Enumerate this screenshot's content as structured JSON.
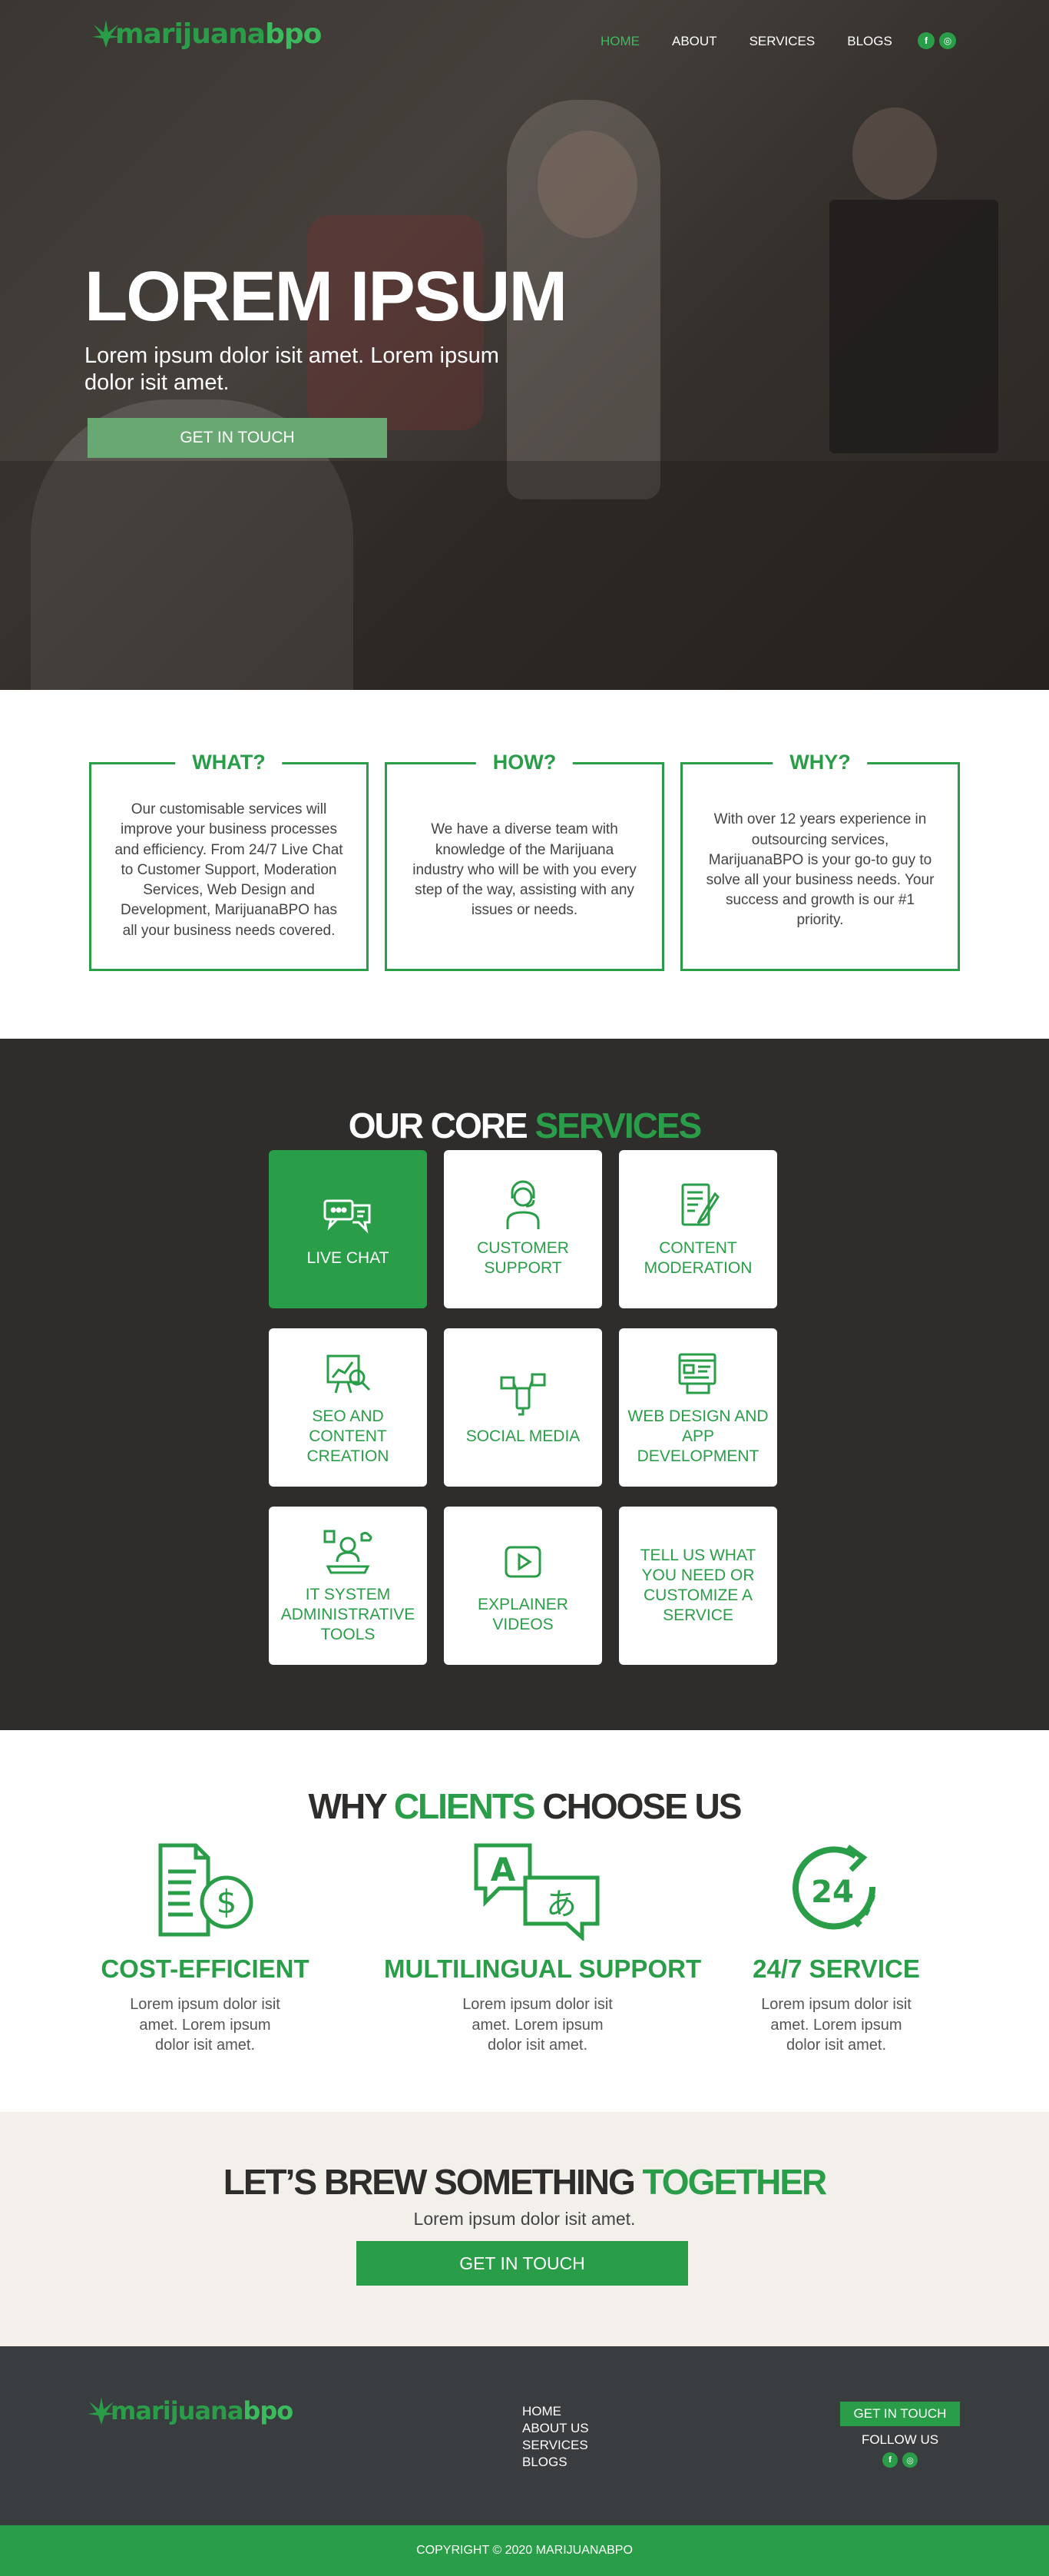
{
  "brand": {
    "logo_part1": "marijuana",
    "logo_part2": "bpo",
    "green": "#2a9d48",
    "light_green": "#3cbb5e",
    "dark": "#2f2d2b"
  },
  "nav": {
    "items": [
      {
        "label": "HOME",
        "active": true
      },
      {
        "label": "ABOUT"
      },
      {
        "label": "SERVICES"
      },
      {
        "label": "BLOGS"
      }
    ],
    "social": [
      "facebook-icon",
      "instagram-icon"
    ]
  },
  "hero": {
    "title": "LOREM IPSUM",
    "subtitle": "Lorem ipsum dolor isit amet. Lorem ipsum dolor isit amet.",
    "button": "GET IN TOUCH"
  },
  "info_boxes": [
    {
      "title": "WHAT?",
      "text": "Our customisable services will improve  your business processes and efficiency. From 24/7 Live Chat to Customer Support, Moderation Services, Web Design and Development, MarijuanaBPO has all your business needs covered."
    },
    {
      "title": "HOW?",
      "text": "We have a diverse team with knowledge of the Marijuana industry who will be with you every step of the way, assisting with any issues or needs."
    },
    {
      "title": "WHY?",
      "text": "With over 12 years experience in outsourcing services, MarijuanaBPO is your go-to guy to solve all your business needs. Your success and growth is our #1 priority."
    }
  ],
  "services": {
    "title_part1": "OUR CORE",
    "title_part2": "SERVICES",
    "items": [
      {
        "label": "LIVE CHAT",
        "icon": "chat-bubbles-icon",
        "active": true
      },
      {
        "label": "CUSTOMER SUPPORT",
        "icon": "headset-agent-icon"
      },
      {
        "label": "CONTENT MODERATION",
        "icon": "document-pen-icon"
      },
      {
        "label": "SEO AND CONTENT CREATION",
        "icon": "seo-chart-icon"
      },
      {
        "label": "SOCIAL MEDIA",
        "icon": "social-media-icon"
      },
      {
        "label": "WEB DESIGN AND APP DEVELOPMENT",
        "icon": "web-design-icon"
      },
      {
        "label": "IT SYSTEM ADMINISTRATIVE TOOLS",
        "icon": "it-admin-icon"
      },
      {
        "label": "EXPLAINER VIDEOS",
        "icon": "play-button-icon"
      },
      {
        "label": "TELL US WHAT YOU NEED OR CUSTOMIZE A SERVICE",
        "icon": ""
      }
    ]
  },
  "why": {
    "title_part1": "WHY",
    "title_part2": "CLIENTS",
    "title_part3": "CHOOSE US",
    "features": [
      {
        "title": "COST-EFFICIENT",
        "text": "Lorem ipsum dolor isit amet. Lorem ipsum dolor isit amet.",
        "icon": "invoice-dollar-icon"
      },
      {
        "title": "MULTILINGUAL SUPPORT",
        "text": "Lorem ipsum dolor isit amet. Lorem ipsum dolor isit amet.",
        "icon": "translate-icon",
        "glyph_a": "A",
        "glyph_b": "あ"
      },
      {
        "title": "24/7 SERVICE",
        "text": "Lorem ipsum dolor isit amet. Lorem ipsum dolor isit amet.",
        "icon": "clock-24-icon",
        "glyph": "24"
      }
    ]
  },
  "cta": {
    "title_part1": "LET’S BREW SOMETHING",
    "title_part2": "TOGETHER",
    "subtitle": "Lorem ipsum dolor isit amet.",
    "button": "GET IN TOUCH"
  },
  "footer": {
    "links": [
      "HOME",
      "ABOUT US",
      "SERVICES",
      "BLOGS"
    ],
    "button": "GET IN TOUCH",
    "follow": "FOLLOW US",
    "copyright": "COPYRIGHT  © 2020 MARIJUANABPO"
  }
}
